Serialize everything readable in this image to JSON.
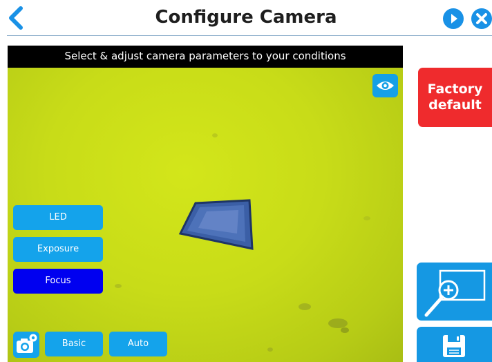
{
  "header": {
    "title": "Configure Camera",
    "back_icon": "chevron-left-icon",
    "play_icon": "play-icon",
    "close_icon": "close-icon"
  },
  "camera_view": {
    "banner_text": "Select & adjust camera parameters to your conditions",
    "preview_icon": "eye-icon",
    "params": [
      {
        "label": "LED",
        "selected": false
      },
      {
        "label": "Exposure",
        "selected": false
      },
      {
        "label": "Focus",
        "selected": true
      }
    ],
    "settings_icon": "camera-settings-icon",
    "modes": [
      {
        "label": "Basic"
      },
      {
        "label": "Auto"
      }
    ]
  },
  "side_panel": {
    "factory_default_label": "Factory default",
    "zoom_icon": "zoom-in-icon",
    "save_icon": "save-icon"
  },
  "colors": {
    "accent": "#1598e3",
    "selected": "#0000f0",
    "danger": "#ef2b2d",
    "camera_background": "#c8dc18"
  }
}
